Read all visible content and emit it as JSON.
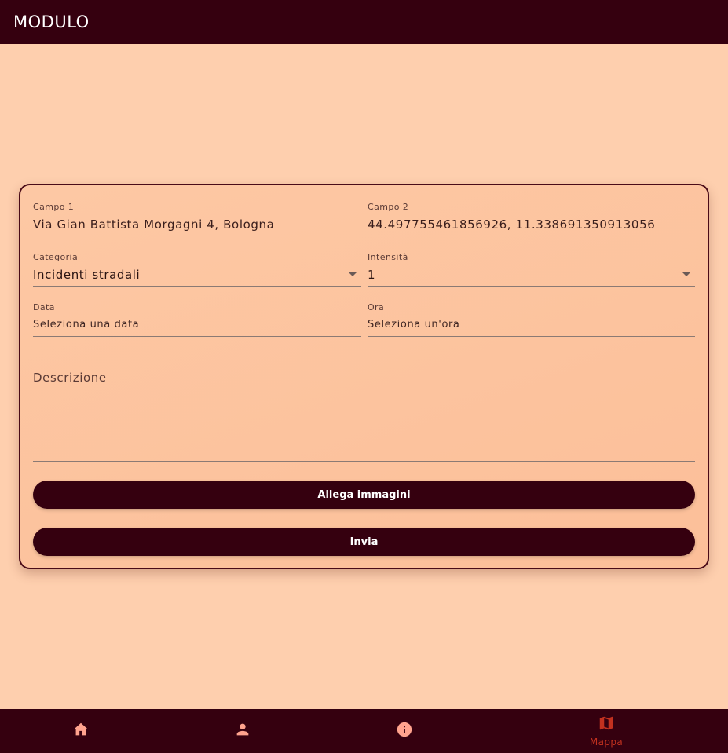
{
  "appbar": {
    "title": "MODULO"
  },
  "form": {
    "campo1": {
      "label": "Campo 1",
      "value": "Via Gian Battista Morgagni 4, Bologna"
    },
    "campo2": {
      "label": "Campo 2",
      "value": "44.497755461856926, 11.338691350913056"
    },
    "categoria": {
      "label": "Categoria",
      "value": "Incidenti stradali"
    },
    "intensita": {
      "label": "Intensità",
      "value": "1"
    },
    "data": {
      "label": "Data",
      "value": "Seleziona una data"
    },
    "ora": {
      "label": "Ora",
      "value": "Seleziona un'ora"
    },
    "descrizione": {
      "placeholder": "Descrizione"
    },
    "attach_label": "Allega immagini",
    "submit_label": "Invia"
  },
  "bottom_nav": {
    "items": [
      {
        "icon": "home-icon",
        "label": ""
      },
      {
        "icon": "person-icon",
        "label": ""
      },
      {
        "icon": "info-icon",
        "label": ""
      },
      {
        "icon": "map-icon",
        "label": "Mappa",
        "selected": true
      }
    ]
  },
  "colors": {
    "background": "#fecfae",
    "primary": "#35000f",
    "card": "#fdc8a4",
    "selected_nav": "#c2311f",
    "nav_icon": "#ffa38e"
  }
}
